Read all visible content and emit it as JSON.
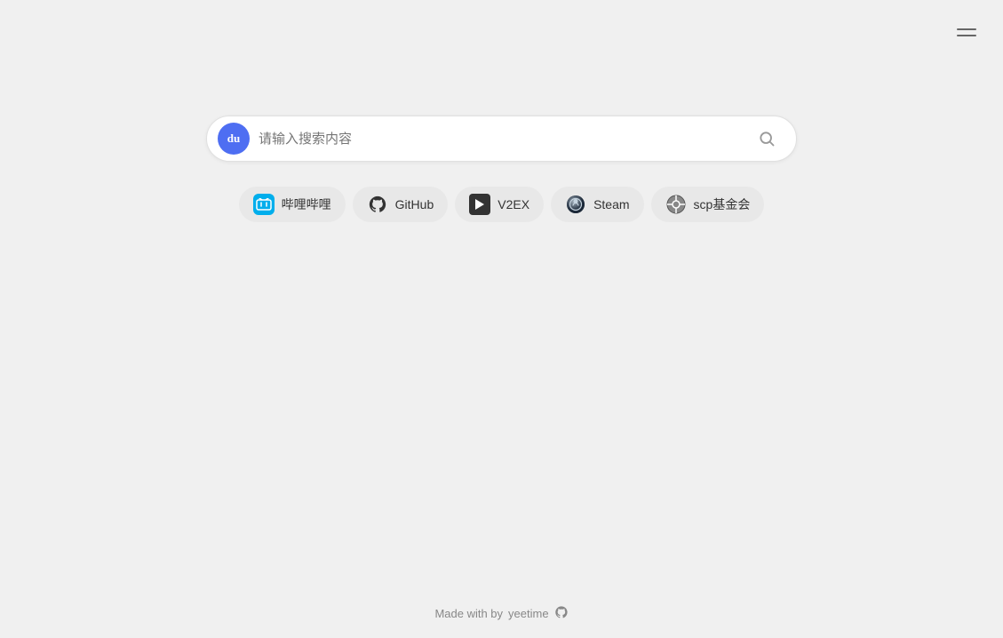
{
  "menu": {
    "label": "menu"
  },
  "search": {
    "placeholder": "请输入搜索内容",
    "baidu_text": "du"
  },
  "shortcuts": [
    {
      "id": "bilibili",
      "label": "哔哩哔哩",
      "icon_type": "bilibili"
    },
    {
      "id": "github",
      "label": "GitHub",
      "icon_type": "github"
    },
    {
      "id": "v2ex",
      "label": "V2EX",
      "icon_type": "v2ex"
    },
    {
      "id": "steam",
      "label": "Steam",
      "icon_type": "steam"
    },
    {
      "id": "scp",
      "label": "scp基金会",
      "icon_type": "scp"
    }
  ],
  "footer": {
    "made_with": "Made with by",
    "author": "yeetime"
  }
}
